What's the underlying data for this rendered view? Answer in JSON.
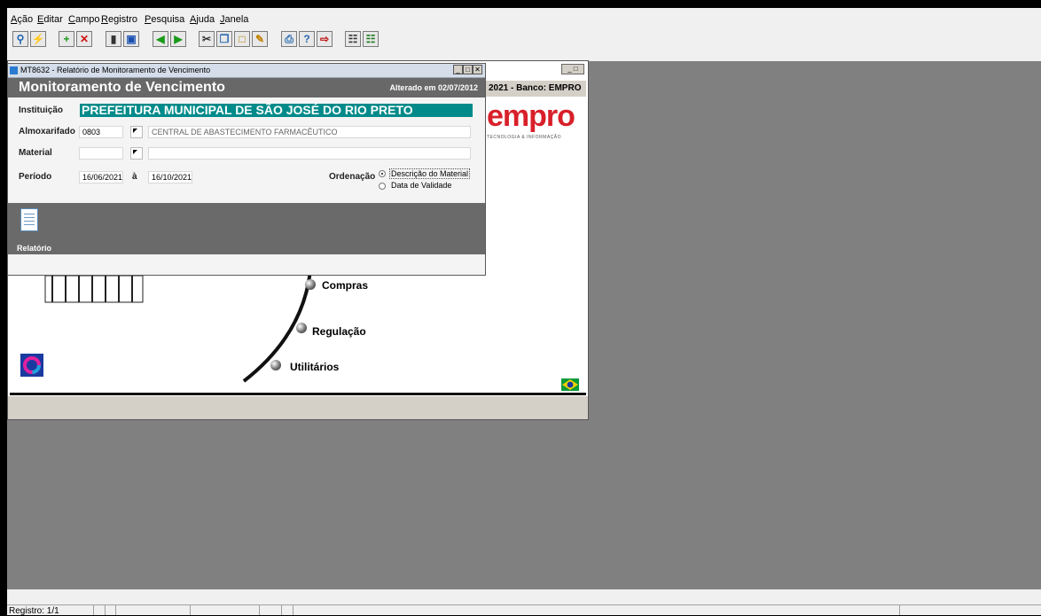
{
  "menu": [
    {
      "label": "Ação",
      "underline": "A"
    },
    {
      "label": "Editar",
      "underline": "E"
    },
    {
      "label": "Campo",
      "underline": "C"
    },
    {
      "label": "Registro",
      "underline": "R"
    },
    {
      "label": "Pesquisa",
      "underline": "P"
    },
    {
      "label": "Ajuda",
      "underline": "A"
    },
    {
      "label": "Janela",
      "underline": "J"
    }
  ],
  "toolbar": {
    "icons": [
      "search-icon",
      "execute-icon",
      "insert-icon",
      "delete-icon",
      "trash-icon",
      "save-icon",
      "previous-icon",
      "next-icon",
      "cut-icon",
      "copy-icon",
      "paste-icon",
      "edit-icon",
      "print-icon",
      "help-icon",
      "exit-icon",
      "report-icon",
      "export-icon"
    ]
  },
  "background_window": {
    "bank_info": "2021 - Banco: EMPRO",
    "logo_text": "empro",
    "logo_sub": "TECNOLOGIA & INFORMAÇÃO",
    "menu_items": [
      "Compras",
      "Regulação",
      "Utilitários"
    ]
  },
  "dialog": {
    "title": "MT8632 - Relatório de Monitoramento de Vencimento",
    "header": "Monitoramento de Vencimento",
    "changed": "Alterado em 02/07/2012",
    "instituicao_label": "Instituição",
    "instituicao_value": "PREFEITURA MUNICIPAL DE SÃO JOSÉ DO RIO PRETO",
    "almox_label": "Almoxarifado",
    "almox_code": "0803",
    "almox_desc": "CENTRAL DE ABASTECIMENTO FARMACÊUTICO",
    "material_label": "Material",
    "material_code": "",
    "material_desc": "",
    "periodo_label": "Período",
    "periodo_start": "16/06/2021",
    "periodo_sep": "à",
    "periodo_end": "16/10/2021",
    "ordenacao_label": "Ordenação",
    "ordenacao_options": [
      "Descrição do Material",
      "Data de Validade"
    ],
    "ordenacao_selected": 0,
    "report_button": "Relatório"
  },
  "status": {
    "record": "Registro: 1/1"
  }
}
